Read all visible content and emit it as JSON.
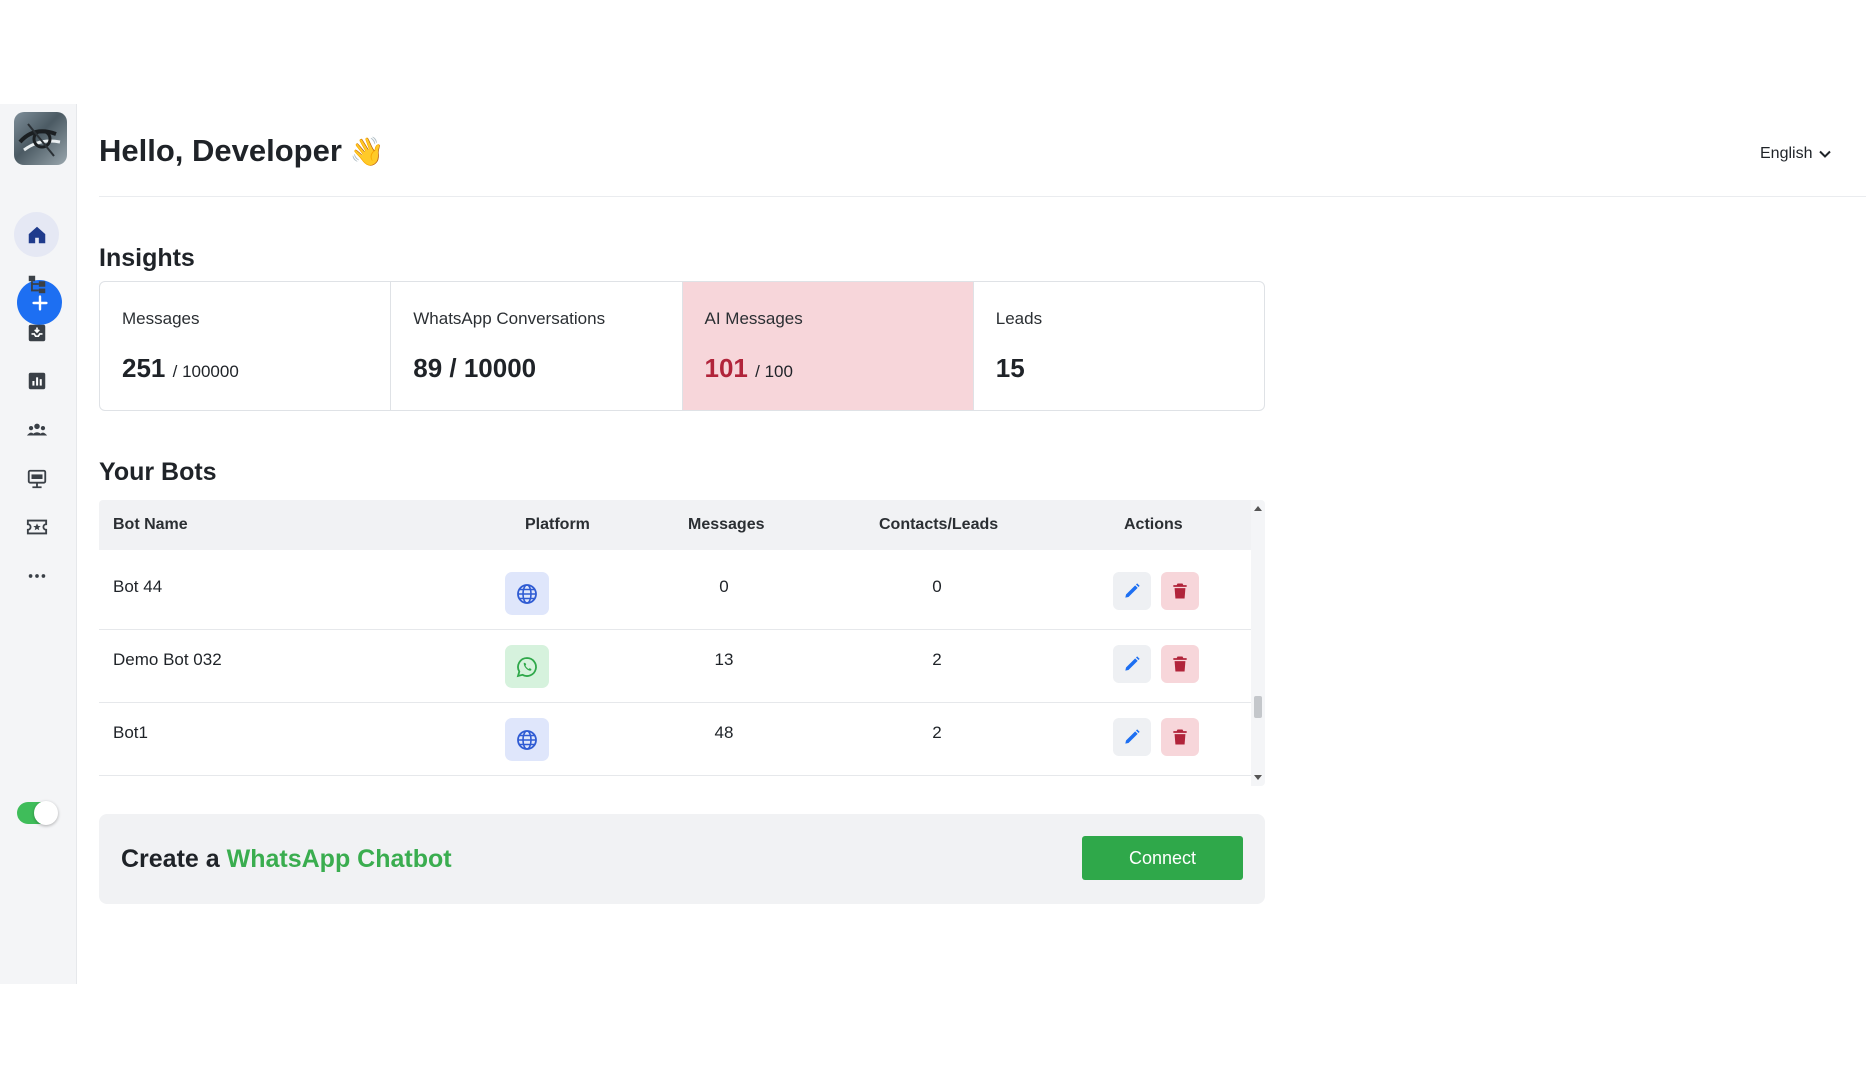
{
  "header": {
    "greeting": "Hello, Developer",
    "greeting_emoji": "👋",
    "language": "English"
  },
  "sidebar": {
    "items": [
      {
        "name": "home-icon",
        "active": true
      },
      {
        "name": "flow-icon",
        "active": false
      },
      {
        "name": "inbox-icon",
        "active": false
      },
      {
        "name": "analytics-icon",
        "active": false
      },
      {
        "name": "contacts-icon",
        "active": false
      },
      {
        "name": "broadcast-icon",
        "active": false
      },
      {
        "name": "ticket-icon",
        "active": false
      },
      {
        "name": "more-icon",
        "active": false
      }
    ],
    "toggle_on": true
  },
  "insights": {
    "title": "Insights",
    "cards": [
      {
        "label": "Messages",
        "value": "251",
        "total": "/ 100000"
      },
      {
        "label": "WhatsApp Conversations",
        "value": "89 / 10000",
        "total": ""
      },
      {
        "label": "AI Messages",
        "value": "101",
        "total": "/ 100"
      },
      {
        "label": "Leads",
        "value": "15",
        "total": ""
      }
    ]
  },
  "bots": {
    "title": "Your Bots",
    "columns": [
      "Bot Name",
      "Platform",
      "Messages",
      "Contacts/Leads",
      "Actions"
    ],
    "rows": [
      {
        "name": "Bot 44",
        "platform": "web",
        "messages": "0",
        "contacts": "0"
      },
      {
        "name": "Demo Bot 032",
        "platform": "whatsapp",
        "messages": "13",
        "contacts": "2"
      },
      {
        "name": "Bot1",
        "platform": "web",
        "messages": "48",
        "contacts": "2"
      }
    ]
  },
  "cta": {
    "prefix": "Create a",
    "accent": "WhatsApp Chatbot",
    "button": "Connect"
  },
  "colors": {
    "primary_blue": "#1d6ff2",
    "whatsapp_green": "#2fa84a",
    "alert_pink": "#f7d6da",
    "alert_red": "#b1243a"
  }
}
